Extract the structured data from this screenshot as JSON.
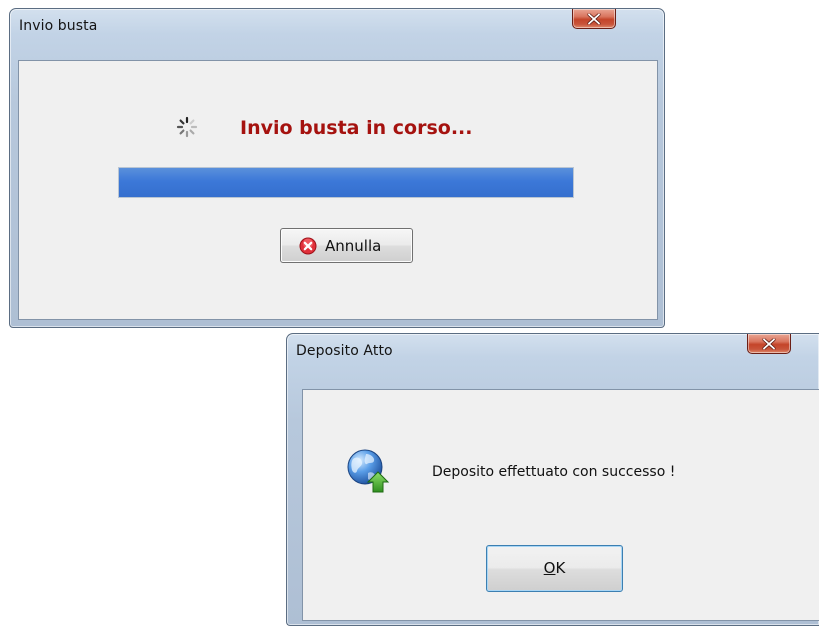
{
  "send_dialog": {
    "title": "Invio busta",
    "status_text": "Invio busta in corso...",
    "progress_fraction": 1.0,
    "cancel_label": "Annulla",
    "icons": {
      "close": "close-icon",
      "spinner": "spinner-icon",
      "cancel": "cancel-icon"
    }
  },
  "deposit_dialog": {
    "title": "Deposito Atto",
    "message": "Deposito effettuato con successo !",
    "ok_label": "OK",
    "ok_mnemonic": "O",
    "ok_rest": "K",
    "icons": {
      "close": "close-icon",
      "info": "globe-upload-icon"
    }
  },
  "colors": {
    "status_text": "#a5120f",
    "progress_fill": "#3c78d8",
    "close_button": "#c4452a",
    "client_background": "#f0f0f0"
  }
}
